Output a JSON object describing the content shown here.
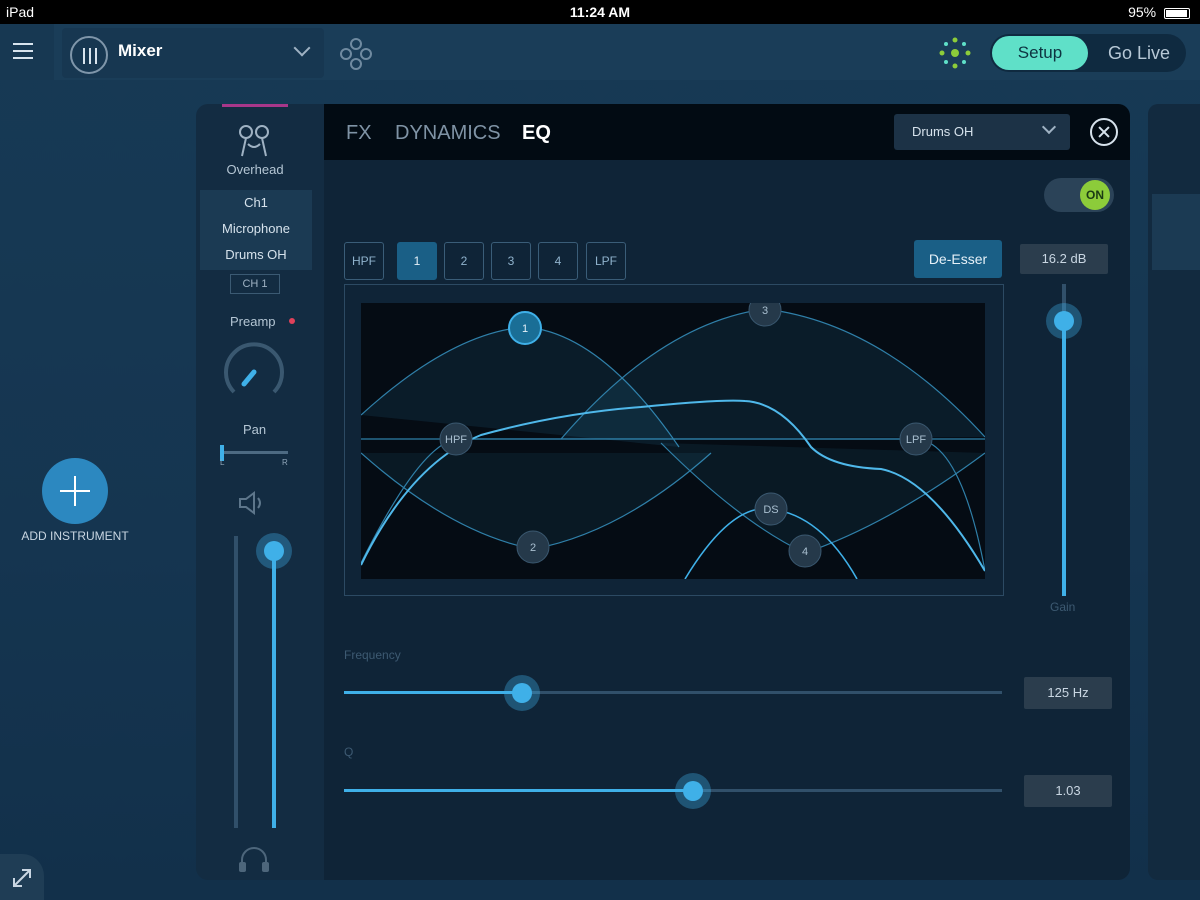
{
  "status_bar": {
    "device": "iPad",
    "time": "11:24 AM",
    "battery": "95%",
    "battery_level": 0.95
  },
  "topbar": {
    "view_name": "Mixer",
    "mode_setup": "Setup",
    "mode_live": "Go Live",
    "active_mode": "Setup"
  },
  "add_instrument": {
    "label": "ADD INSTRUMENT"
  },
  "channel": {
    "instrument": "Overhead",
    "info": [
      "Ch1",
      "Microphone",
      "Drums OH"
    ],
    "badge": "CH 1",
    "preamp_label": "Preamp",
    "pan_label": "Pan",
    "pan_left": "L",
    "pan_right": "R",
    "pan_position": 0.0,
    "fader_level": 0.95
  },
  "eq_panel": {
    "tabs": [
      "FX",
      "DYNAMICS",
      "EQ"
    ],
    "active_tab": "EQ",
    "preset": "Drums OH",
    "on_label": "ON",
    "bands": [
      "HPF",
      "1",
      "2",
      "3",
      "4",
      "LPF"
    ],
    "selected_band": "1",
    "deesser_label": "De-Esser",
    "gain_value": "16.2 dB",
    "gain_label": "Gain",
    "gain_level": 0.88,
    "frequency_label": "Frequency",
    "frequency_value": "125 Hz",
    "frequency_position": 0.27,
    "q_label": "Q",
    "q_value": "1.03",
    "q_position": 0.53,
    "nodes": [
      "1",
      "2",
      "3",
      "4",
      "HPF",
      "LPF",
      "DS"
    ]
  },
  "colors": {
    "accent": "#3fb0e8",
    "setup_active": "#5fe0c8",
    "on_green": "#8ccc3a",
    "preamp_dot": "#e0415a"
  },
  "icons": [
    "menu-icon",
    "mixer-icon",
    "chevron-down-icon",
    "diamond-icon",
    "network-icon",
    "plus-icon",
    "expand-icon",
    "instrument-icon",
    "knob-icon",
    "speaker-icon",
    "headphone-icon",
    "close-icon"
  ]
}
